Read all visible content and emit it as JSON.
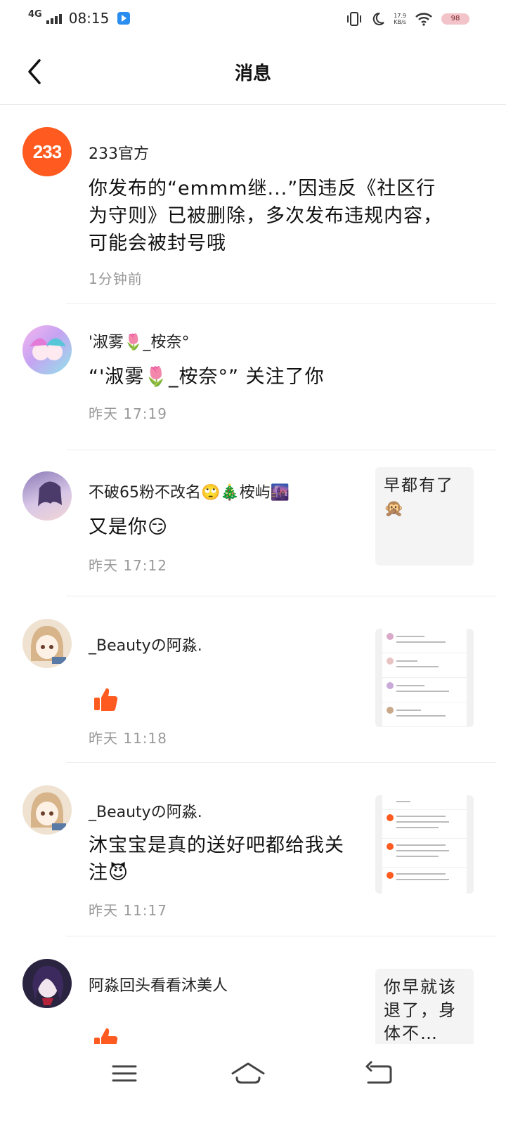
{
  "status_bar": {
    "network": "4G",
    "time": "08:15",
    "speed_value": "17.9",
    "speed_unit": "KB/s",
    "battery": "98"
  },
  "header": {
    "title": "消息"
  },
  "messages": [
    {
      "username": "233官方",
      "avatar_text": "233",
      "content": "你发布的“emmm继...”因违反《社区行为守则》已被删除，多次发布违规内容，可能会被封号哦",
      "time": "1分钟前"
    },
    {
      "username": "'淑雾🌷_桉奈°",
      "content": "“'淑雾🌷_桉奈°” 关注了你",
      "time": "昨天 17:19"
    },
    {
      "username": "不破65粉不改名🙄🎄桉屿🌆",
      "content": "又是你😏",
      "time": "昨天 17:12",
      "thumb_text": "早都有了🙊"
    },
    {
      "username": "_Beautyの阿淼.",
      "content": "",
      "time": "昨天 11:18",
      "like": true
    },
    {
      "username": "_Beautyの阿淼.",
      "content": "沐宝宝是真的送好吧都给我关注😈",
      "time": "昨天 11:17"
    },
    {
      "username": "阿淼回头看看沐美人",
      "content": "",
      "like": true,
      "thumb_text": "你早就该退了，身体不…"
    }
  ],
  "colors": {
    "accent": "#ff5a1f",
    "divider": "#ececec",
    "time_text": "#999999"
  },
  "icons": {
    "back": "chevron-left",
    "like": "thumbs-up",
    "menu": "hamburger",
    "home": "home",
    "return": "back-arrow"
  }
}
